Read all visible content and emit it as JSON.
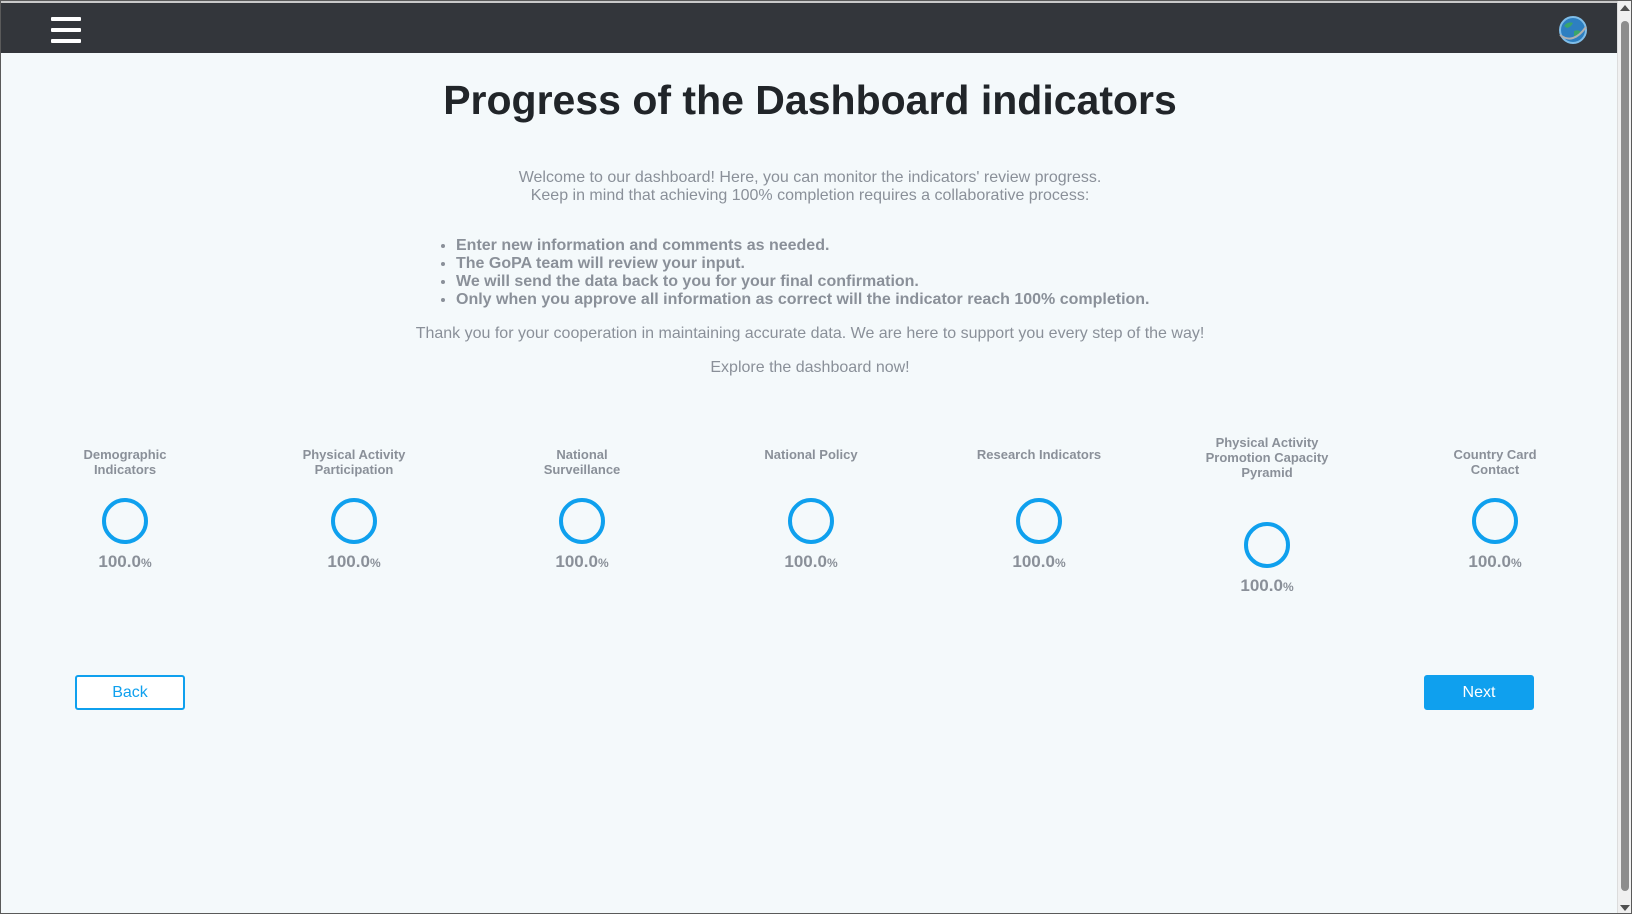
{
  "header": {
    "menu_icon": "hamburger-menu-icon",
    "logo_icon": "globe-logo-icon"
  },
  "page": {
    "title": "Progress of the Dashboard indicators",
    "intro_line1": "Welcome to our dashboard! Here, you can monitor the indicators' review progress.",
    "intro_line2": "Keep in mind that achieving 100% completion requires a collaborative process:",
    "bullets": [
      "Enter new information and comments as needed.",
      "The GoPA team will review your input.",
      "We will send the data back to you for your final confirmation.",
      "Only when you approve all information as correct will the indicator reach 100% completion."
    ],
    "thanks": "Thank you for your cooperation in maintaining accurate data. We are here to support you every step of the way!",
    "explore": "Explore the dashboard now!"
  },
  "indicators": [
    {
      "label": "Demographic Indicators",
      "value": "100.0",
      "unit": "%",
      "progress": 1.0
    },
    {
      "label": "Physical Activity Participation",
      "value": "100.0",
      "unit": "%",
      "progress": 1.0
    },
    {
      "label": "National Surveillance",
      "value": "100.0",
      "unit": "%",
      "progress": 1.0
    },
    {
      "label": "National Policy",
      "value": "100.0",
      "unit": "%",
      "progress": 1.0
    },
    {
      "label": "Research Indicators",
      "value": "100.0",
      "unit": "%",
      "progress": 1.0
    },
    {
      "label": "Physical Activity Promotion Capacity Pyramid",
      "value": "100.0",
      "unit": "%",
      "progress": 1.0
    },
    {
      "label": "Country Card Contact",
      "value": "100.0",
      "unit": "%",
      "progress": 1.0
    }
  ],
  "buttons": {
    "back": "Back",
    "next": "Next"
  },
  "colors": {
    "accent": "#0fa0ee",
    "topbar": "#33363b",
    "background": "#f4f9fb",
    "muted_text": "#8a9099",
    "title_text": "#212529"
  }
}
